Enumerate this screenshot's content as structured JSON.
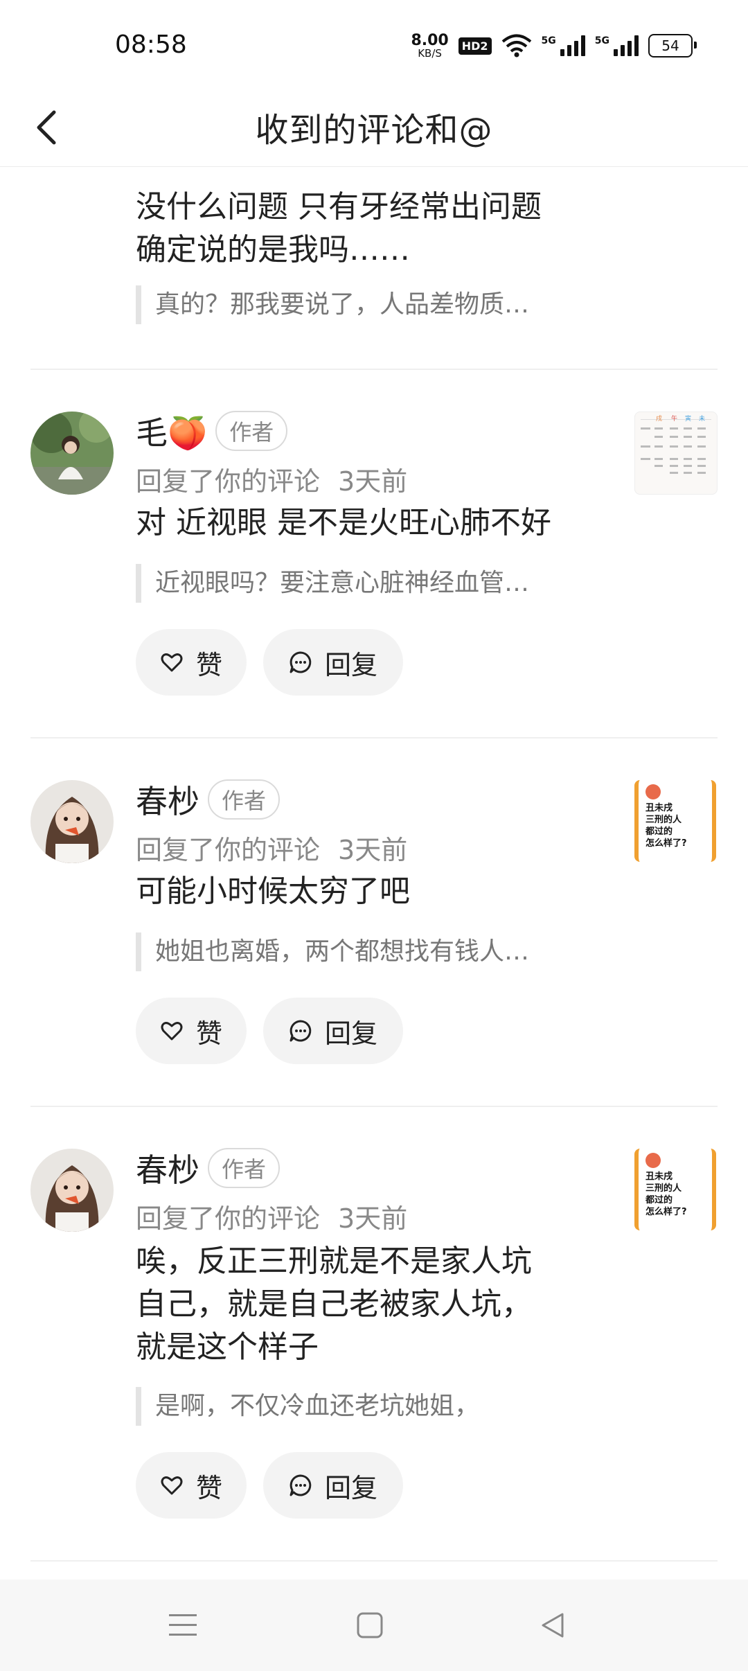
{
  "status": {
    "time": "08:58",
    "net_speed_value": "8.00",
    "net_speed_unit": "KB/S",
    "hd_badge": "HD2",
    "signal1_label": "5G",
    "signal2_label": "5G",
    "battery": "54"
  },
  "header": {
    "title": "收到的评论和@"
  },
  "partial_item": {
    "text_lines": [
      "没什么问题 只有牙经常出问题",
      "确定说的是我吗……"
    ],
    "quote": "真的？那我要说了，人品差物质…"
  },
  "items": [
    {
      "username": "毛🍑",
      "author_tag": "作者",
      "action": "回复了你的评论",
      "time": "3天前",
      "text": "对 近视眼 是不是火旺心肺不好",
      "quote": "近视眼吗？要注意心脏神经血管…",
      "like_label": "赞",
      "reply_label": "回复"
    },
    {
      "username": "春杪",
      "author_tag": "作者",
      "action": "回复了你的评论",
      "time": "3天前",
      "text": "可能小时候太穷了吧",
      "quote": "她姐也离婚，两个都想找有钱人…",
      "like_label": "赞",
      "reply_label": "回复",
      "thumb_lines": [
        "丑未戌",
        "三刑的人",
        "都过的",
        "怎么样了?"
      ]
    },
    {
      "username": "春杪",
      "author_tag": "作者",
      "action": "回复了你的评论",
      "time": "3天前",
      "text_lines": [
        "唉，反正三刑就是不是家人坑",
        "自己，就是自己老被家人坑，",
        "就是这个样子"
      ],
      "quote": "是啊，不仅冷血还老坑她姐，",
      "like_label": "赞",
      "reply_label": "回复",
      "thumb_lines": [
        "丑未戌",
        "三刑的人",
        "都过的",
        "怎么样了?"
      ]
    }
  ]
}
